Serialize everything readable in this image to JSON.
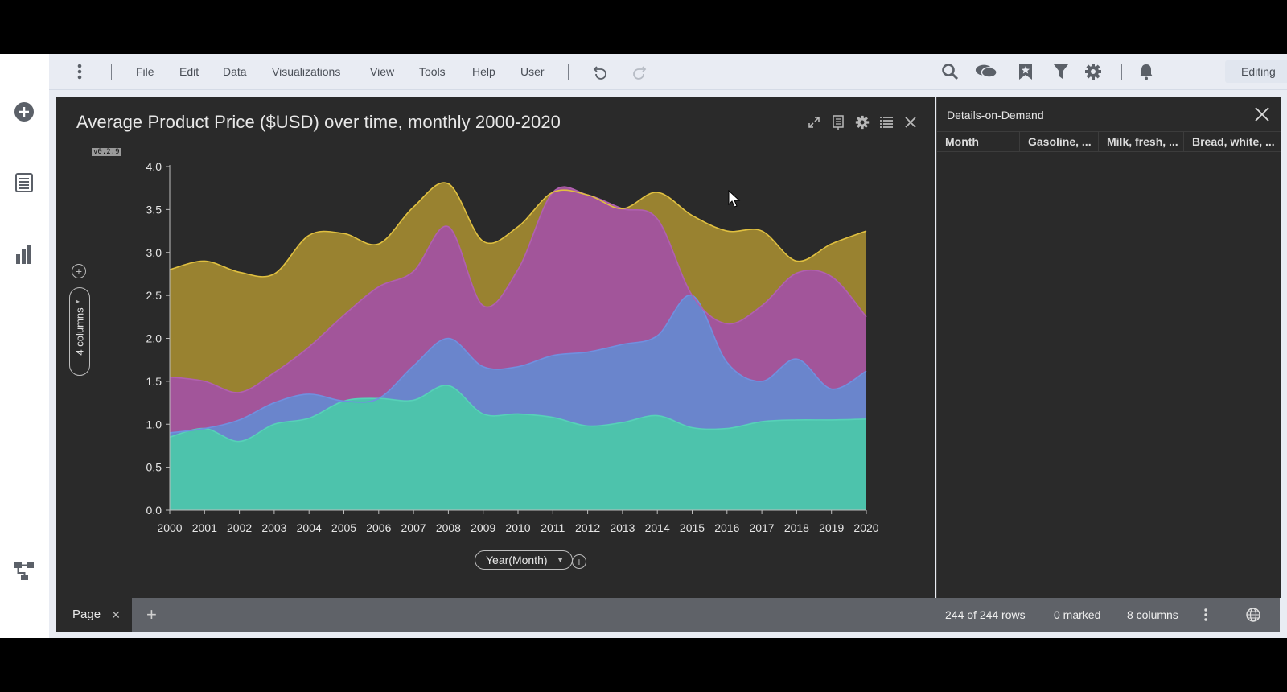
{
  "menu": {
    "items": [
      "File",
      "Edit",
      "Data",
      "Visualizations",
      "View",
      "Tools",
      "Help",
      "User"
    ],
    "mode": "Editing"
  },
  "icons": {
    "left_sidebar": [
      "add-circle-icon",
      "list-icon",
      "bar-chart-icon",
      "data-flow-icon"
    ],
    "menubar_right": [
      "search-icon",
      "chat-icon",
      "bookmark-icon",
      "filter-icon",
      "gear-icon",
      "bell-icon"
    ],
    "viz_tools": [
      "maximize-icon",
      "export-icon",
      "gear-icon",
      "legend-icon",
      "close-icon"
    ]
  },
  "visualization": {
    "title": "Average Product Price ($USD) over time, monthly 2000-2020",
    "version": "v0.2.9",
    "columns_pill": "4 columns",
    "x_axis_selector": "Year(Month)"
  },
  "details": {
    "title": "Details-on-Demand",
    "columns": [
      "Month",
      "Gasoline, ...",
      "Milk, fresh, ...",
      "Bread, white, ..."
    ]
  },
  "status": {
    "page_tab": "Page",
    "rows": "244 of 244 rows",
    "marked": "0 marked",
    "columns": "8 columns"
  },
  "colors": {
    "background": "#2a2a2a",
    "series_teal": "#4dc3ac",
    "series_blue": "#6a85cc",
    "series_magenta": "#a2559a",
    "series_gold": "#998230"
  },
  "chart_data": {
    "type": "area",
    "stacked": true,
    "x": [
      2000,
      2001,
      2002,
      2003,
      2004,
      2005,
      2006,
      2007,
      2008,
      2009,
      2010,
      2011,
      2012,
      2013,
      2014,
      2015,
      2016,
      2017,
      2018,
      2019,
      2020
    ],
    "ylim": [
      0,
      4.0
    ],
    "yticks": [
      0.0,
      0.5,
      1.0,
      1.5,
      2.0,
      2.5,
      3.0,
      3.5,
      4.0
    ],
    "grid": false,
    "series": [
      {
        "color": "#4dc3ac",
        "line": "#57d1b8",
        "values": [
          0.85,
          0.95,
          0.8,
          1.0,
          1.07,
          1.27,
          1.3,
          1.28,
          1.45,
          1.12,
          1.12,
          1.08,
          0.98,
          1.02,
          1.1,
          0.96,
          0.95,
          1.03,
          1.05,
          1.05,
          1.06
        ]
      },
      {
        "color": "#6a85cc",
        "line": "#7090e0",
        "values": [
          0.05,
          0.0,
          0.25,
          0.25,
          0.28,
          0.0,
          0.0,
          0.4,
          0.55,
          0.55,
          0.55,
          0.72,
          0.86,
          0.91,
          0.93,
          1.54,
          0.77,
          0.47,
          0.71,
          0.36,
          0.56
        ]
      },
      {
        "color": "#a2559a",
        "line": "#b060b0",
        "values": [
          0.65,
          0.55,
          0.32,
          0.35,
          0.55,
          1.0,
          1.3,
          1.1,
          1.3,
          0.71,
          1.13,
          1.9,
          1.83,
          1.58,
          1.36,
          0.0,
          0.45,
          0.88,
          1.0,
          1.31,
          0.63
        ]
      },
      {
        "color": "#998230",
        "line": "#e0c040",
        "values": [
          1.25,
          1.4,
          1.4,
          1.15,
          1.3,
          0.95,
          0.5,
          0.75,
          0.5,
          0.75,
          0.5,
          0.0,
          0.0,
          0.0,
          0.31,
          0.93,
          1.08,
          0.87,
          0.14,
          0.38,
          1.0
        ]
      }
    ]
  }
}
